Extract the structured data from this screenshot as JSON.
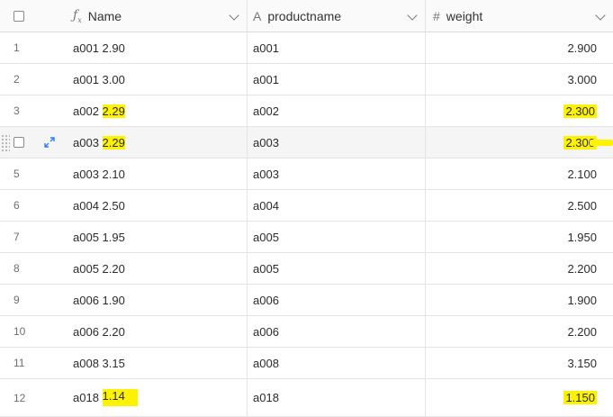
{
  "columns": {
    "name": {
      "icon": "formula-icon",
      "label": "Name"
    },
    "productname": {
      "icon": "text-field-icon",
      "label": "productname"
    },
    "weight": {
      "icon": "number-field-icon",
      "label": "weight"
    }
  },
  "rows": [
    {
      "index": "1",
      "name": "a001 2.90",
      "productname": "a001",
      "weight": "2.900"
    },
    {
      "index": "2",
      "name": "a001 3.00",
      "productname": "a001",
      "weight": "3.000"
    },
    {
      "index": "3",
      "name_prefix": "a002 ",
      "name_hl": "2.29",
      "productname": "a002",
      "weight": "2.300"
    },
    {
      "index": "",
      "name_prefix": "a003 ",
      "name_hl": "2.29",
      "productname": "a003",
      "weight": "2.300"
    },
    {
      "index": "5",
      "name": "a003 2.10",
      "productname": "a003",
      "weight": "2.100"
    },
    {
      "index": "6",
      "name": "a004 2.50",
      "productname": "a004",
      "weight": "2.500"
    },
    {
      "index": "7",
      "name": "a005 1.95",
      "productname": "a005",
      "weight": "1.950"
    },
    {
      "index": "8",
      "name": "a005 2.20",
      "productname": "a005",
      "weight": "2.200"
    },
    {
      "index": "9",
      "name": "a006 1.90",
      "productname": "a006",
      "weight": "1.900"
    },
    {
      "index": "10",
      "name": "a006 2.20",
      "productname": "a006",
      "weight": "2.200"
    },
    {
      "index": "11",
      "name": "a008 3.15",
      "productname": "a008",
      "weight": "3.150"
    },
    {
      "index": "12",
      "name_prefix": "a018 ",
      "name_hl": "1.14",
      "productname": "a018",
      "weight": "1.150"
    }
  ],
  "highlight_color": "#fdf200",
  "icons": {
    "expand": "expand-record-icon",
    "drag": "drag-handle-icon",
    "checkbox": "checkbox"
  }
}
